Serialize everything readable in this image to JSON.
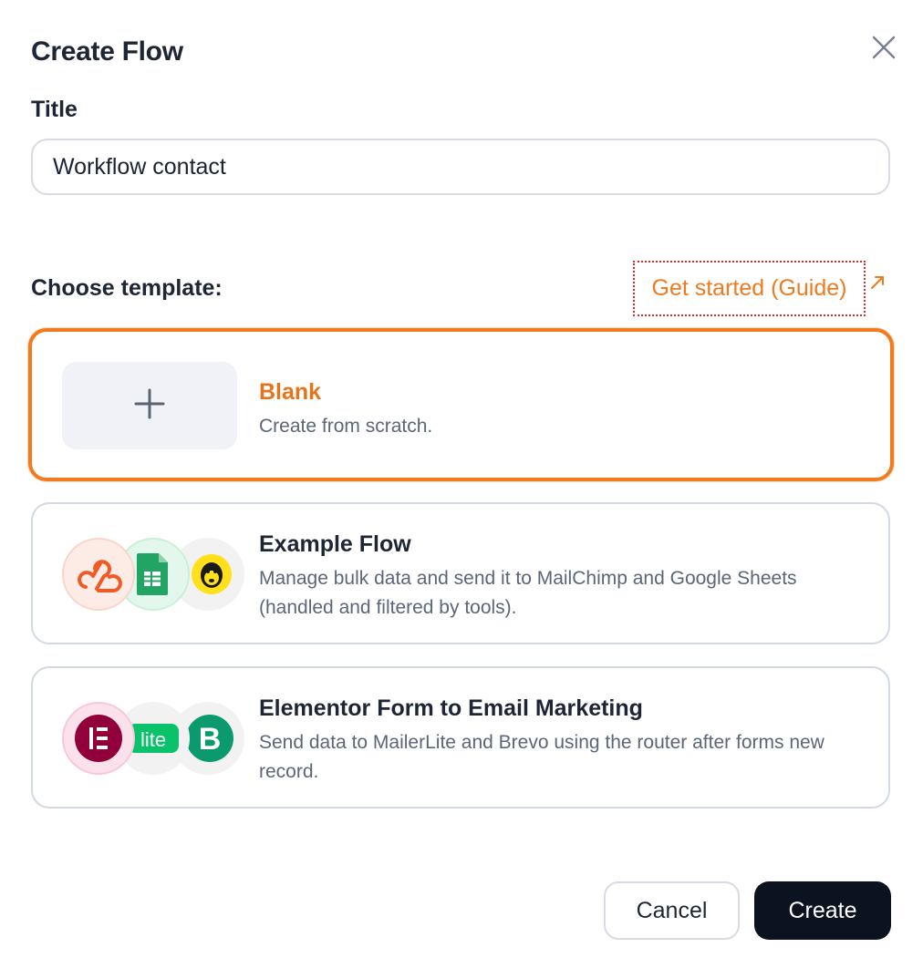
{
  "dialog": {
    "title": "Create Flow",
    "close_icon": "close-icon"
  },
  "form": {
    "title_label": "Title",
    "title_value": "Workflow contact",
    "choose_label": "Choose template:",
    "guide_link": "Get started (Guide)",
    "guide_icon": "external-link-arrow-icon"
  },
  "templates": [
    {
      "name": "Blank",
      "description": "Create from scratch.",
      "selected": true,
      "icon": "plus-icon"
    },
    {
      "name": "Example Flow",
      "description": "Manage bulk data and send it to MailChimp and Google Sheets (handled and filtered by tools).",
      "selected": false,
      "icons": [
        "webhook-icon",
        "google-sheets-icon",
        "mailchimp-icon"
      ]
    },
    {
      "name": "Elementor Form to Email Marketing",
      "description": "Send data to MailerLite and Brevo using the router after forms new record.",
      "selected": false,
      "icons": [
        "elementor-icon",
        "mailerlite-icon",
        "brevo-icon"
      ],
      "icon_text": {
        "elementor": "E",
        "mailerlite": "lite",
        "brevo": "B"
      }
    }
  ],
  "actions": {
    "cancel_label": "Cancel",
    "create_label": "Create"
  },
  "colors": {
    "accent": "#f07c1f",
    "primary_button": "#0b1220",
    "text": "#1e2535",
    "muted": "#5b6678"
  }
}
